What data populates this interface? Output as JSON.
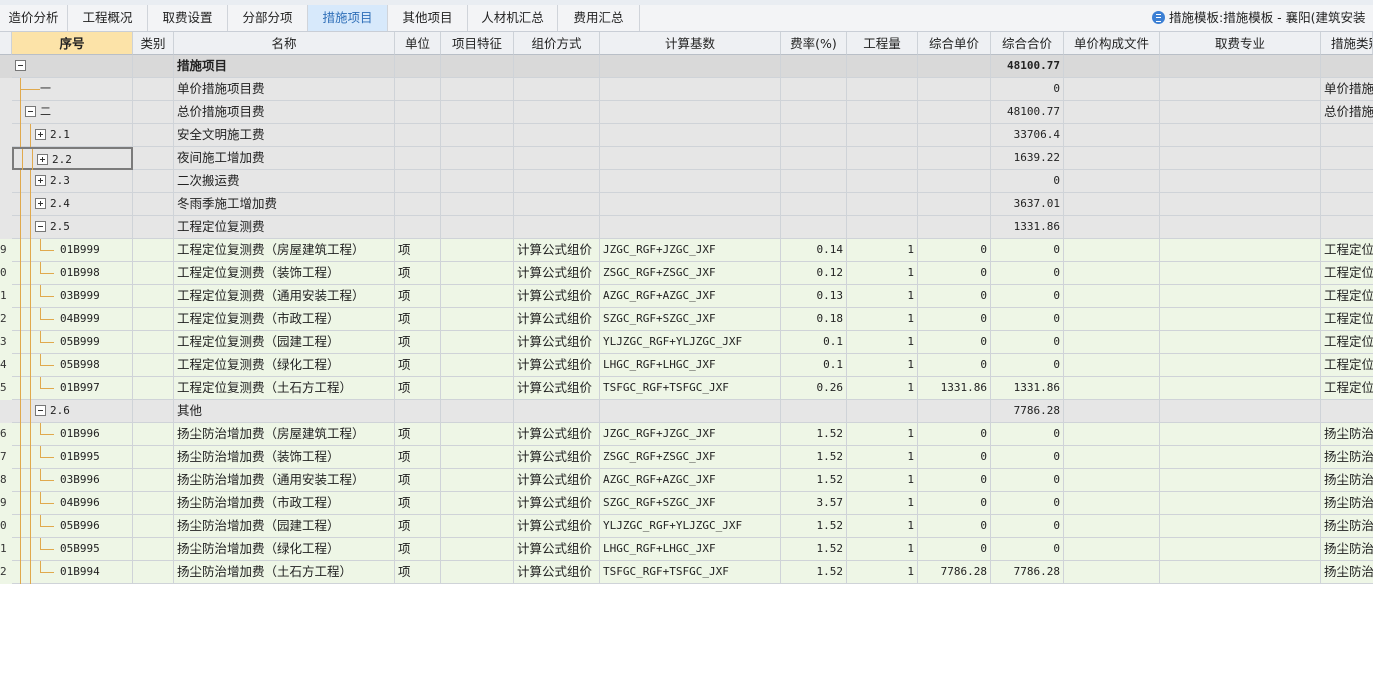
{
  "tabs": [
    {
      "label": "造价分析",
      "active": false
    },
    {
      "label": "工程概况",
      "active": false
    },
    {
      "label": "取费设置",
      "active": false
    },
    {
      "label": "分部分项",
      "active": false
    },
    {
      "label": "措施项目",
      "active": true
    },
    {
      "label": "其他项目",
      "active": false
    },
    {
      "label": "人材机汇总",
      "active": false
    },
    {
      "label": "费用汇总",
      "active": false
    }
  ],
  "template_info": {
    "icon": "template-doc-icon",
    "text": "措施模板:措施模板 - 襄阳(建筑安装"
  },
  "columns": [
    "序号",
    "类别",
    "名称",
    "单位",
    "项目特征",
    "组价方式",
    "计算基数",
    "费率(%)",
    "工程量",
    "综合单价",
    "综合合价",
    "单价构成文件",
    "取费专业",
    "措施类别"
  ],
  "rows": [
    {
      "rn": "",
      "seq": "",
      "tog": "minus",
      "lvl": 0,
      "name": "措施项目",
      "unit": "",
      "method": "",
      "base": "",
      "rate": "",
      "qty": "",
      "price": "",
      "total": "48100.77",
      "cat": "",
      "style": "root"
    },
    {
      "rn": "",
      "seq": "一",
      "tog": "",
      "lvl": 1,
      "name": "单价措施项目费",
      "unit": "",
      "method": "",
      "base": "",
      "rate": "",
      "qty": "",
      "price": "",
      "total": "0",
      "cat": "单价措施",
      "style": "gray"
    },
    {
      "rn": "",
      "seq": "二",
      "tog": "minus",
      "lvl": 1,
      "name": "总价措施项目费",
      "unit": "",
      "method": "",
      "base": "",
      "rate": "",
      "qty": "",
      "price": "",
      "total": "48100.77",
      "cat": "总价措施",
      "style": "gray"
    },
    {
      "rn": "",
      "seq": "2.1",
      "tog": "plus",
      "lvl": 2,
      "name": "安全文明施工费",
      "unit": "",
      "method": "",
      "base": "",
      "rate": "",
      "qty": "",
      "price": "",
      "total": "33706.4",
      "cat": "",
      "style": "gray"
    },
    {
      "rn": "",
      "seq": "2.2",
      "tog": "plus",
      "lvl": 2,
      "name": "夜间施工增加费",
      "unit": "",
      "method": "",
      "base": "",
      "rate": "",
      "qty": "",
      "price": "",
      "total": "1639.22",
      "cat": "",
      "style": "gray",
      "focus": true
    },
    {
      "rn": "",
      "seq": "2.3",
      "tog": "plus",
      "lvl": 2,
      "name": "二次搬运费",
      "unit": "",
      "method": "",
      "base": "",
      "rate": "",
      "qty": "",
      "price": "",
      "total": "0",
      "cat": "",
      "style": "gray"
    },
    {
      "rn": "",
      "seq": "2.4",
      "tog": "plus",
      "lvl": 2,
      "name": "冬雨季施工增加费",
      "unit": "",
      "method": "",
      "base": "",
      "rate": "",
      "qty": "",
      "price": "",
      "total": "3637.01",
      "cat": "",
      "style": "gray"
    },
    {
      "rn": "",
      "seq": "2.5",
      "tog": "minus",
      "lvl": 2,
      "name": "工程定位复测费",
      "unit": "",
      "method": "",
      "base": "",
      "rate": "",
      "qty": "",
      "price": "",
      "total": "1331.86",
      "cat": "",
      "style": "gray"
    },
    {
      "rn": "9",
      "seq": "01B999",
      "tog": "",
      "lvl": 3,
      "name": "工程定位复测费（房屋建筑工程）",
      "unit": "项",
      "method": "计算公式组价",
      "base": "JZGC_RGF+JZGC_JXF",
      "rate": "0.14",
      "qty": "1",
      "price": "0",
      "total": "0",
      "cat": "工程定位",
      "style": "green"
    },
    {
      "rn": "0",
      "seq": "01B998",
      "tog": "",
      "lvl": 3,
      "name": "工程定位复测费（装饰工程）",
      "unit": "项",
      "method": "计算公式组价",
      "base": "ZSGC_RGF+ZSGC_JXF",
      "rate": "0.12",
      "qty": "1",
      "price": "0",
      "total": "0",
      "cat": "工程定位",
      "style": "green"
    },
    {
      "rn": "1",
      "seq": "03B999",
      "tog": "",
      "lvl": 3,
      "name": "工程定位复测费（通用安装工程）",
      "unit": "项",
      "method": "计算公式组价",
      "base": "AZGC_RGF+AZGC_JXF",
      "rate": "0.13",
      "qty": "1",
      "price": "0",
      "total": "0",
      "cat": "工程定位",
      "style": "green"
    },
    {
      "rn": "2",
      "seq": "04B999",
      "tog": "",
      "lvl": 3,
      "name": "工程定位复测费（市政工程）",
      "unit": "项",
      "method": "计算公式组价",
      "base": "SZGC_RGF+SZGC_JXF",
      "rate": "0.18",
      "qty": "1",
      "price": "0",
      "total": "0",
      "cat": "工程定位",
      "style": "green"
    },
    {
      "rn": "3",
      "seq": "05B999",
      "tog": "",
      "lvl": 3,
      "name": "工程定位复测费（园建工程）",
      "unit": "项",
      "method": "计算公式组价",
      "base": "YLJZGC_RGF+YLJZGC_JXF",
      "rate": "0.1",
      "qty": "1",
      "price": "0",
      "total": "0",
      "cat": "工程定位",
      "style": "green"
    },
    {
      "rn": "4",
      "seq": "05B998",
      "tog": "",
      "lvl": 3,
      "name": "工程定位复测费（绿化工程）",
      "unit": "项",
      "method": "计算公式组价",
      "base": "LHGC_RGF+LHGC_JXF",
      "rate": "0.1",
      "qty": "1",
      "price": "0",
      "total": "0",
      "cat": "工程定位",
      "style": "green"
    },
    {
      "rn": "5",
      "seq": "01B997",
      "tog": "",
      "lvl": 3,
      "name": "工程定位复测费（土石方工程）",
      "unit": "项",
      "method": "计算公式组价",
      "base": "TSFGC_RGF+TSFGC_JXF",
      "rate": "0.26",
      "qty": "1",
      "price": "1331.86",
      "total": "1331.86",
      "cat": "工程定位",
      "style": "green"
    },
    {
      "rn": "",
      "seq": "2.6",
      "tog": "minus",
      "lvl": 2,
      "name": "其他",
      "unit": "",
      "method": "",
      "base": "",
      "rate": "",
      "qty": "",
      "price": "",
      "total": "7786.28",
      "cat": "",
      "style": "gray"
    },
    {
      "rn": "6",
      "seq": "01B996",
      "tog": "",
      "lvl": 3,
      "name": "扬尘防治增加费（房屋建筑工程）",
      "unit": "项",
      "method": "计算公式组价",
      "base": "JZGC_RGF+JZGC_JXF",
      "rate": "1.52",
      "qty": "1",
      "price": "0",
      "total": "0",
      "cat": "扬尘防治",
      "style": "green"
    },
    {
      "rn": "7",
      "seq": "01B995",
      "tog": "",
      "lvl": 3,
      "name": "扬尘防治增加费（装饰工程）",
      "unit": "项",
      "method": "计算公式组价",
      "base": "ZSGC_RGF+ZSGC_JXF",
      "rate": "1.52",
      "qty": "1",
      "price": "0",
      "total": "0",
      "cat": "扬尘防治",
      "style": "green"
    },
    {
      "rn": "8",
      "seq": "03B996",
      "tog": "",
      "lvl": 3,
      "name": "扬尘防治增加费（通用安装工程）",
      "unit": "项",
      "method": "计算公式组价",
      "base": "AZGC_RGF+AZGC_JXF",
      "rate": "1.52",
      "qty": "1",
      "price": "0",
      "total": "0",
      "cat": "扬尘防治",
      "style": "green"
    },
    {
      "rn": "9",
      "seq": "04B996",
      "tog": "",
      "lvl": 3,
      "name": "扬尘防治增加费（市政工程）",
      "unit": "项",
      "method": "计算公式组价",
      "base": "SZGC_RGF+SZGC_JXF",
      "rate": "3.57",
      "qty": "1",
      "price": "0",
      "total": "0",
      "cat": "扬尘防治",
      "style": "green"
    },
    {
      "rn": "0",
      "seq": "05B996",
      "tog": "",
      "lvl": 3,
      "name": "扬尘防治增加费（园建工程）",
      "unit": "项",
      "method": "计算公式组价",
      "base": "YLJZGC_RGF+YLJZGC_JXF",
      "rate": "1.52",
      "qty": "1",
      "price": "0",
      "total": "0",
      "cat": "扬尘防治",
      "style": "green"
    },
    {
      "rn": "1",
      "seq": "05B995",
      "tog": "",
      "lvl": 3,
      "name": "扬尘防治增加费（绿化工程）",
      "unit": "项",
      "method": "计算公式组价",
      "base": "LHGC_RGF+LHGC_JXF",
      "rate": "1.52",
      "qty": "1",
      "price": "0",
      "total": "0",
      "cat": "扬尘防治",
      "style": "green"
    },
    {
      "rn": "2",
      "seq": "01B994",
      "tog": "",
      "lvl": 3,
      "name": "扬尘防治增加费（土石方工程）",
      "unit": "项",
      "method": "计算公式组价",
      "base": "TSFGC_RGF+TSFGC_JXF",
      "rate": "1.52",
      "qty": "1",
      "price": "7786.28",
      "total": "7786.28",
      "cat": "扬尘防治",
      "style": "green"
    }
  ]
}
